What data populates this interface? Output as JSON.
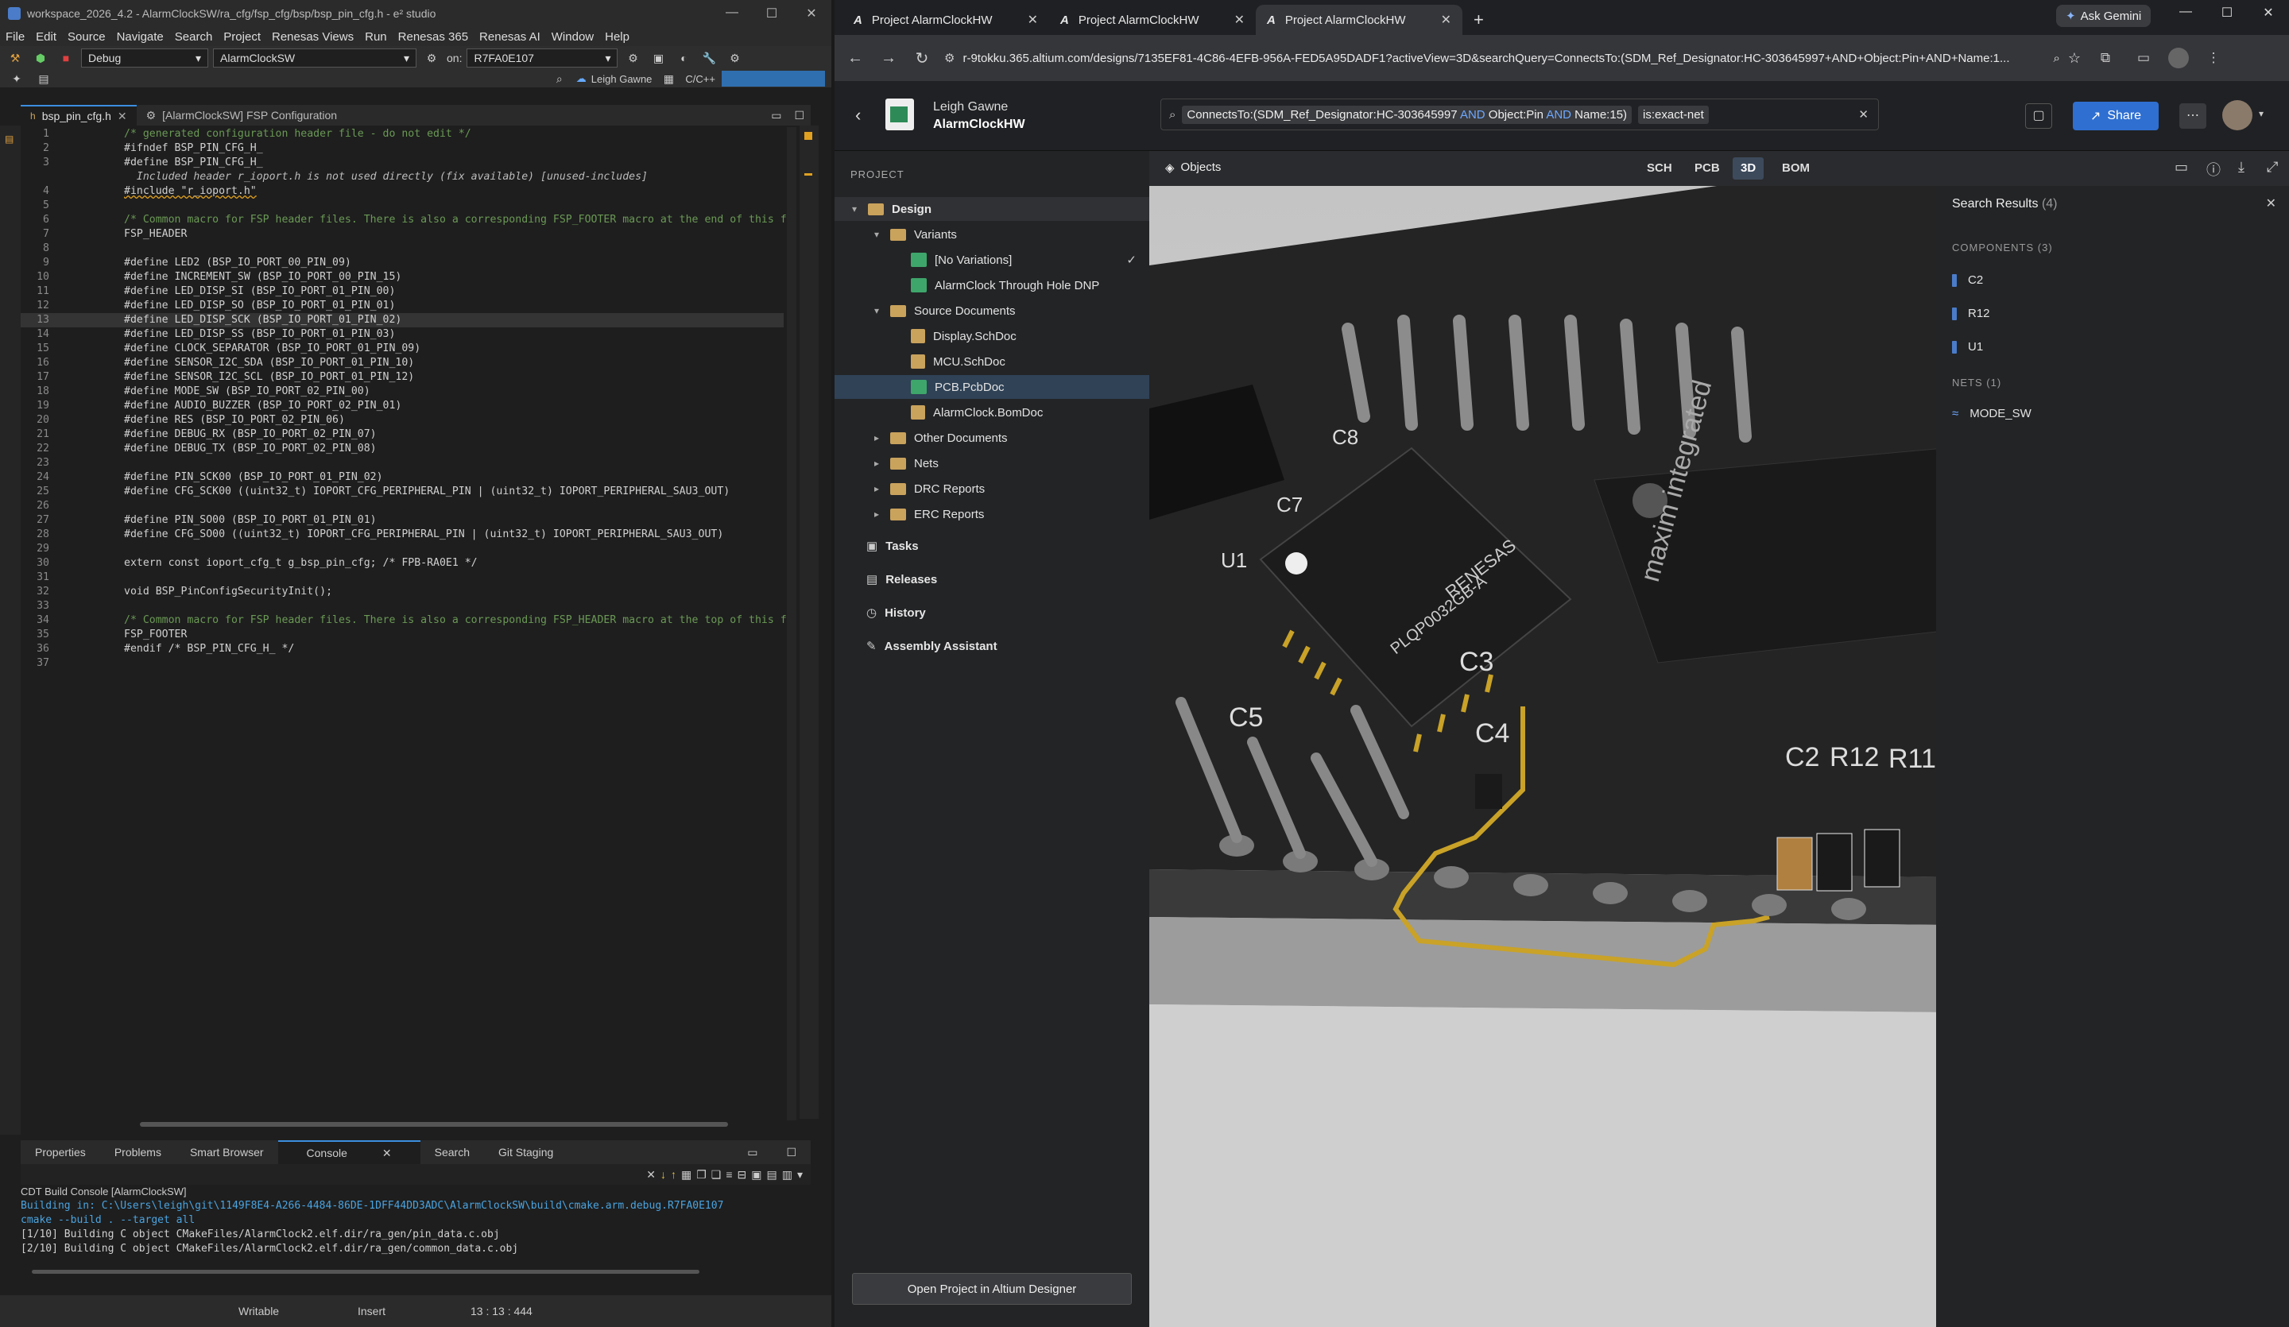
{
  "ide": {
    "title": "workspace_2026_4.2 - AlarmClockSW/ra_cfg/fsp_cfg/bsp/bsp_pin_cfg.h - e² studio",
    "menu": [
      "File",
      "Edit",
      "Source",
      "Navigate",
      "Search",
      "Project",
      "Renesas Views",
      "Run",
      "Renesas 365",
      "Renesas AI",
      "Window",
      "Help"
    ],
    "toolbar": {
      "config": "Debug",
      "project": "AlarmClockSW",
      "on_label": "on:",
      "target": "R7FA0E107",
      "user": "Leigh Gawne",
      "perspective": "C/C++"
    },
    "tabs": [
      {
        "label": "bsp_pin_cfg.h"
      },
      {
        "label": "[AlarmClockSW] FSP Configuration"
      }
    ],
    "code": [
      {
        "n": "1",
        "t": "/* generated configuration header file - do not edit */",
        "c": "cm"
      },
      {
        "n": "2",
        "t": "#ifndef BSP_PIN_CFG_H_",
        "c": ""
      },
      {
        "n": "3",
        "t": "#define BSP_PIN_CFG_H_",
        "c": ""
      },
      {
        "n": "",
        "t": "  Included header r_ioport.h is not used directly (fix available) [unused-includes]",
        "c": "warn"
      },
      {
        "n": "4",
        "t": "#include \"r_ioport.h\"",
        "c": "inc"
      },
      {
        "n": "5",
        "t": "",
        "c": ""
      },
      {
        "n": "6",
        "t": "/* Common macro for FSP header files. There is also a corresponding FSP_FOOTER macro at the end of this f",
        "c": "cm"
      },
      {
        "n": "7",
        "t": "FSP_HEADER",
        "c": ""
      },
      {
        "n": "8",
        "t": "",
        "c": ""
      },
      {
        "n": "9",
        "t": "#define LED2 (BSP_IO_PORT_00_PIN_09)",
        "c": ""
      },
      {
        "n": "10",
        "t": "#define INCREMENT_SW (BSP_IO_PORT_00_PIN_15)",
        "c": ""
      },
      {
        "n": "11",
        "t": "#define LED_DISP_SI (BSP_IO_PORT_01_PIN_00)",
        "c": ""
      },
      {
        "n": "12",
        "t": "#define LED_DISP_SO (BSP_IO_PORT_01_PIN_01)",
        "c": ""
      },
      {
        "n": "13",
        "t": "#define LED_DISP_SCK (BSP_IO_PORT_01_PIN_02)",
        "c": "hl"
      },
      {
        "n": "14",
        "t": "#define LED_DISP_SS (BSP_IO_PORT_01_PIN_03)",
        "c": ""
      },
      {
        "n": "15",
        "t": "#define CLOCK_SEPARATOR (BSP_IO_PORT_01_PIN_09)",
        "c": ""
      },
      {
        "n": "16",
        "t": "#define SENSOR_I2C_SDA (BSP_IO_PORT_01_PIN_10)",
        "c": ""
      },
      {
        "n": "17",
        "t": "#define SENSOR_I2C_SCL (BSP_IO_PORT_01_PIN_12)",
        "c": ""
      },
      {
        "n": "18",
        "t": "#define MODE_SW (BSP_IO_PORT_02_PIN_00)",
        "c": ""
      },
      {
        "n": "19",
        "t": "#define AUDIO_BUZZER (BSP_IO_PORT_02_PIN_01)",
        "c": ""
      },
      {
        "n": "20",
        "t": "#define RES (BSP_IO_PORT_02_PIN_06)",
        "c": ""
      },
      {
        "n": "21",
        "t": "#define DEBUG_RX (BSP_IO_PORT_02_PIN_07)",
        "c": ""
      },
      {
        "n": "22",
        "t": "#define DEBUG_TX (BSP_IO_PORT_02_PIN_08)",
        "c": ""
      },
      {
        "n": "23",
        "t": "",
        "c": ""
      },
      {
        "n": "24",
        "t": "#define PIN_SCK00 (BSP_IO_PORT_01_PIN_02)",
        "c": ""
      },
      {
        "n": "25",
        "t": "#define CFG_SCK00 ((uint32_t) IOPORT_CFG_PERIPHERAL_PIN | (uint32_t) IOPORT_PERIPHERAL_SAU3_OUT)",
        "c": ""
      },
      {
        "n": "26",
        "t": "",
        "c": ""
      },
      {
        "n": "27",
        "t": "#define PIN_SO00 (BSP_IO_PORT_01_PIN_01)",
        "c": ""
      },
      {
        "n": "28",
        "t": "#define CFG_SO00 ((uint32_t) IOPORT_CFG_PERIPHERAL_PIN | (uint32_t) IOPORT_PERIPHERAL_SAU3_OUT)",
        "c": ""
      },
      {
        "n": "29",
        "t": "",
        "c": ""
      },
      {
        "n": "30",
        "t": "extern const ioport_cfg_t g_bsp_pin_cfg; /* FPB-RA0E1 */",
        "c": ""
      },
      {
        "n": "31",
        "t": "",
        "c": ""
      },
      {
        "n": "32",
        "t": "void BSP_PinConfigSecurityInit();",
        "c": ""
      },
      {
        "n": "33",
        "t": "",
        "c": ""
      },
      {
        "n": "34",
        "t": "/* Common macro for FSP header files. There is also a corresponding FSP_HEADER macro at the top of this f",
        "c": "cm"
      },
      {
        "n": "35",
        "t": "FSP_FOOTER",
        "c": ""
      },
      {
        "n": "36",
        "t": "#endif /* BSP_PIN_CFG_H_ */",
        "c": ""
      },
      {
        "n": "37",
        "t": "",
        "c": ""
      }
    ],
    "bottom_tabs": [
      "Properties",
      "Problems",
      "Smart Browser",
      "Console",
      "Search",
      "Git Staging"
    ],
    "console": {
      "header": "CDT Build Console [AlarmClockSW]",
      "lines": [
        {
          "t": "Building in: C:\\Users\\leigh\\git\\1149F8E4-A266-4484-86DE-1DFF44DD3ADC\\AlarmClockSW\\build\\cmake.arm.debug.R7FA0E107",
          "c": "b"
        },
        {
          "t": "cmake --build . --target all",
          "c": "b"
        },
        {
          "t": "[1/10] Building C object CMakeFiles/AlarmClock2.elf.dir/ra_gen/pin_data.c.obj",
          "c": "n"
        },
        {
          "t": "[2/10] Building C object CMakeFiles/AlarmClock2.elf.dir/ra_gen/common_data.c.obj",
          "c": "n"
        }
      ]
    },
    "status": {
      "writable": "Writable",
      "insert": "Insert",
      "position": "13 : 13 : 444"
    }
  },
  "browser": {
    "tabs": [
      {
        "label": "Project AlarmClockHW"
      },
      {
        "label": "Project AlarmClockHW"
      },
      {
        "label": "Project AlarmClockHW"
      }
    ],
    "ask_gemini": "Ask Gemini",
    "url": "r-9tokku.365.altium.com/designs/7135EF81-4C86-4EFB-956A-FED5A95DADF1?activeView=3D&searchQuery=ConnectsTo:(SDM_Ref_Designator:HC-303645997+AND+Object:Pin+AND+Name:1..."
  },
  "altium": {
    "user": "Leigh Gawne",
    "project": "AlarmClockHW",
    "search": {
      "q1": "ConnectsTo:(SDM_Ref_Designator:HC-303645997",
      "and1": "AND",
      "q2": "Object:Pin",
      "and2": "AND",
      "q3": "Name:15)",
      "filter": "is:exact-net"
    },
    "share": "Share",
    "objects_label": "Objects",
    "views": [
      "SCH",
      "PCB",
      "3D",
      "BOM"
    ],
    "project_header": "PROJECT",
    "tree": {
      "design": "Design",
      "variants": "Variants",
      "no_var": "[No Variations]",
      "alarm_dnp": "AlarmClock Through Hole DNP",
      "source": "Source Documents",
      "display": "Display.SchDoc",
      "mcu": "MCU.SchDoc",
      "pcb": "PCB.PcbDoc",
      "bom": "AlarmClock.BomDoc",
      "other": "Other Documents",
      "nets": "Nets",
      "drc": "DRC Reports",
      "erc": "ERC Reports"
    },
    "nav": [
      "Tasks",
      "Releases",
      "History",
      "Assembly Assistant"
    ],
    "open_button": "Open Project in Altium Designer",
    "results": {
      "title": "Search Results",
      "count": "(4)",
      "components_header": "COMPONENTS (3)",
      "components": [
        "C2",
        "R12",
        "U1"
      ],
      "nets_header": "NETS (1)",
      "nets": [
        "MODE_SW"
      ]
    },
    "board_labels": {
      "c2": "C2",
      "r12": "R12",
      "r11": "R11",
      "c5": "C5",
      "c4": "C4",
      "c3": "C3",
      "c7": "C7",
      "c8": "C8",
      "u1": "U1",
      "chip": "RENESAS",
      "chipcode": "PLQP0032GB-A",
      "maxim": "maxim integrated"
    }
  },
  "colors": {
    "accent": "#3c8ee0",
    "share": "#2f6fd1",
    "trace": "#c9a227",
    "folder": "#c9a25c",
    "doc_active": "#3ea66b"
  }
}
